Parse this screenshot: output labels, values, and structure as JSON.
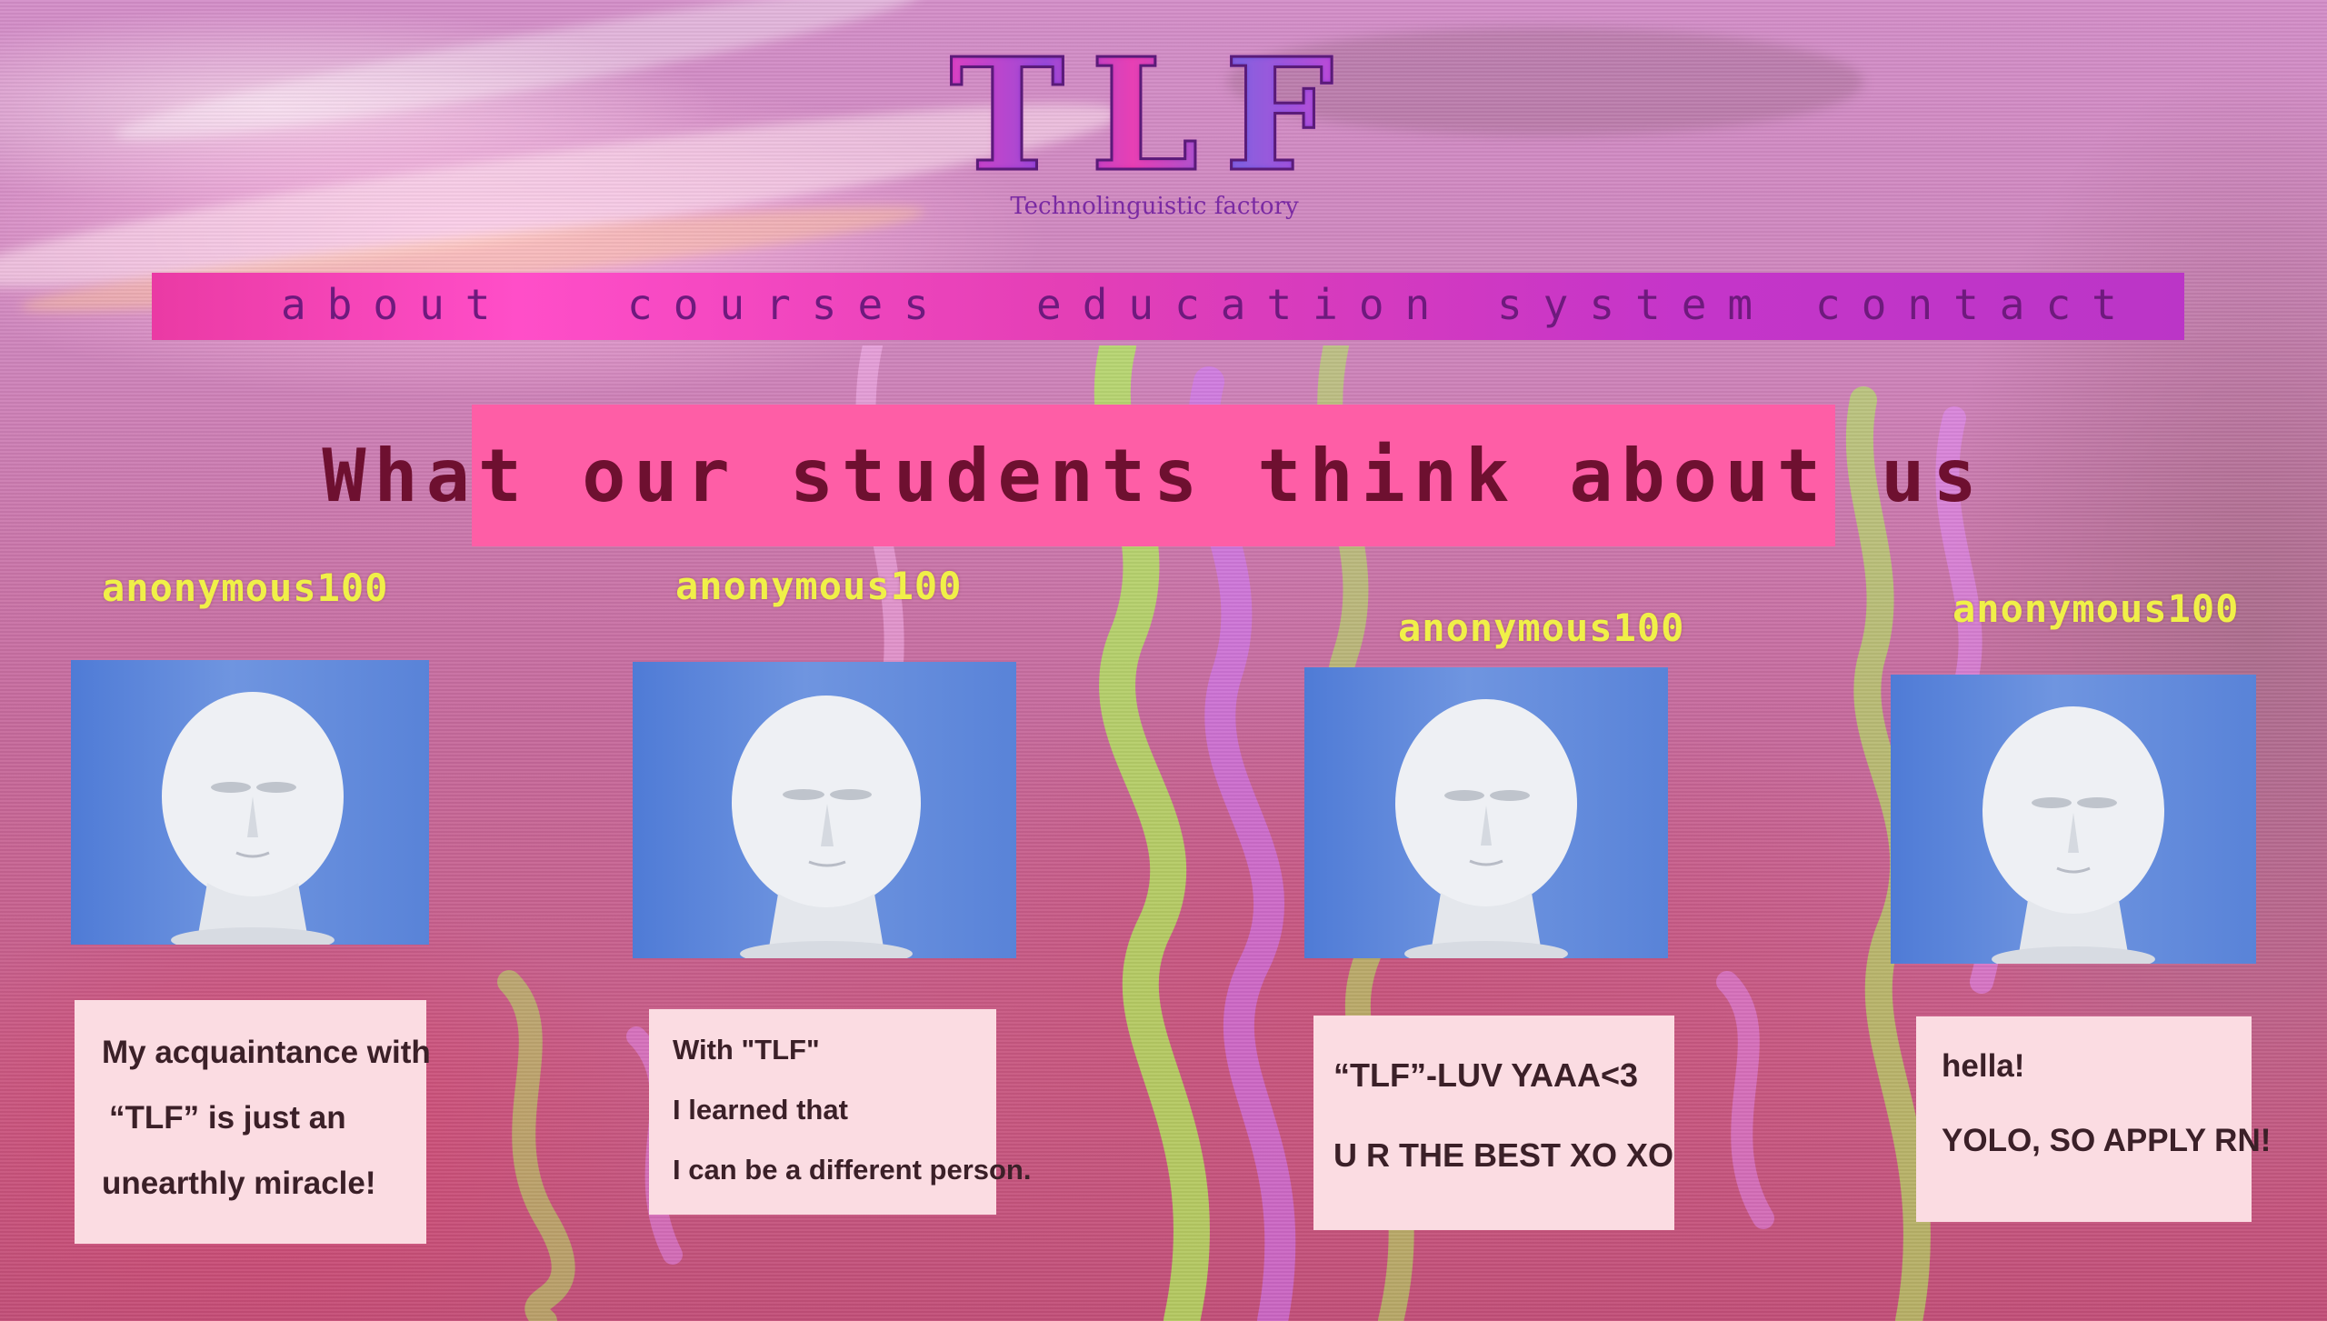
{
  "logo": {
    "mark": "TLF",
    "tagline": "Technolinguistic factory"
  },
  "nav": {
    "items": [
      {
        "label": "about"
      },
      {
        "label": "courses"
      },
      {
        "label": "education system"
      },
      {
        "label": "contact"
      }
    ]
  },
  "banner": {
    "title": "What our students think about us"
  },
  "testimonials": [
    {
      "username": "anonymous100",
      "avatar": "mannequin-head-icon",
      "lines": [
        "My acquaintance with",
        "“TLF” is just an",
        "unearthly miracle!"
      ]
    },
    {
      "username": "anonymous100",
      "avatar": "mannequin-head-icon",
      "lines": [
        "With \"TLF\"",
        "I learned that",
        "I can be a different person."
      ]
    },
    {
      "username": "anonymous100",
      "avatar": "mannequin-head-icon",
      "lines": [
        "“TLF”-LUV YAAA<3",
        "U R THE BEST XO XO"
      ]
    },
    {
      "username": "anonymous100",
      "avatar": "mannequin-head-icon",
      "lines": [
        "hella!",
        "YOLO, SO APPLY RN!"
      ]
    }
  ],
  "colors": {
    "nav_bar": "#ea3aa4",
    "nav_text": "#6e1a7d",
    "banner_bg": "#fe5ea6",
    "banner_text": "#6e1030",
    "username_text": "#f0f048",
    "quote_bg": "#fbdce2",
    "avatar_bg": "#5f8adb"
  }
}
